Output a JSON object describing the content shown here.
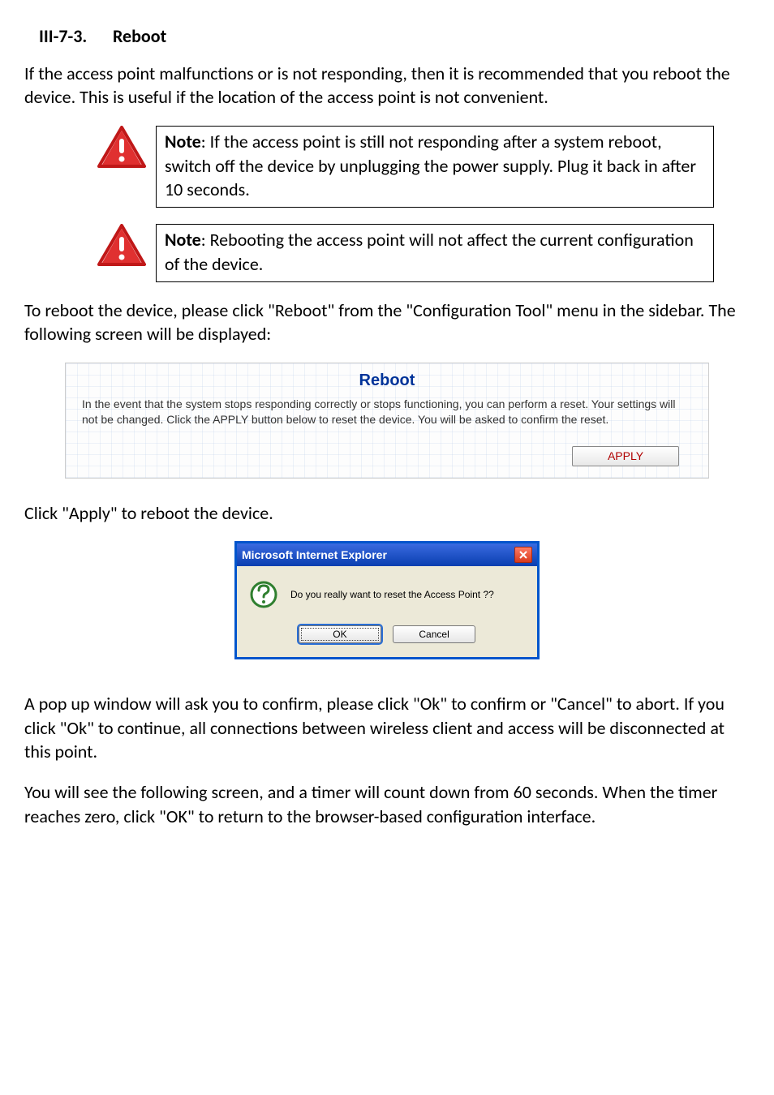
{
  "heading": {
    "number": "III-7-3.",
    "title": "Reboot"
  },
  "intro": "If the access point malfunctions or is not responding, then it is recommended that you reboot the device. This is useful if the location of the access point is not convenient.",
  "notes": [
    {
      "label": "Note",
      "text": ": If the access point is still not responding after a system reboot, switch off the device by unplugging the power supply. Plug it back in after 10 seconds."
    },
    {
      "label": "Note",
      "text": ": Rebooting the access point will not affect the current configuration of the device."
    }
  ],
  "para_to_reboot": "To reboot the device, please click \"Reboot\" from the \"Configuration Tool\" menu in the sidebar. The following screen will be displayed:",
  "reboot_panel": {
    "title": "Reboot",
    "desc": "In the event that the system stops responding correctly or stops functioning, you can perform a reset. Your settings will not be changed. Click the APPLY button below to reset the device. You will be asked to confirm the reset.",
    "apply": "APPLY"
  },
  "para_click_apply": "Click \"Apply\" to reboot the device.",
  "dialog": {
    "title": "Microsoft Internet Explorer",
    "message": "Do you really want to reset the Access Point ??",
    "ok": "OK",
    "cancel": "Cancel"
  },
  "para_popup": "A pop up window will ask you to confirm, please click \"Ok\" to confirm or \"Cancel\" to abort. If you click \"Ok\" to continue, all connections between wireless client and access will be disconnected at this point.",
  "para_timer": "You will see the following screen, and a timer will count down from 60 seconds. When the timer reaches zero, click \"OK\" to return to the browser-based configuration interface."
}
